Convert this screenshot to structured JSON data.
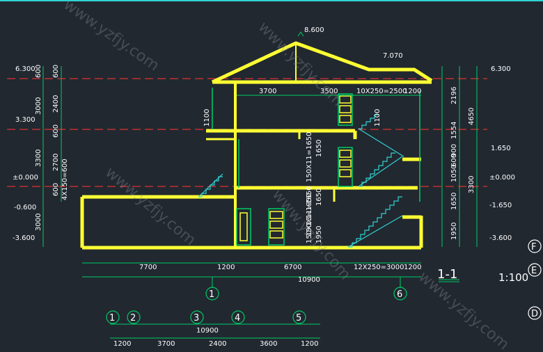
{
  "drawing": {
    "title": "1-1",
    "scale": "1:100",
    "ridge_elevation": "8.600",
    "eave_elevation": "7.070"
  },
  "elevations_left": [
    "6.300",
    "3.300",
    "±0.000",
    "-0.600",
    "-3.600"
  ],
  "elevations_right": [
    "6.300",
    "1.650",
    "±0.000",
    "-1.650",
    "-3.600"
  ],
  "dims_left_outer": [
    "600",
    "3000",
    "3300",
    "3000"
  ],
  "dims_left_inner": [
    "600",
    "2400",
    "600",
    "2700",
    "600",
    "4X150=600"
  ],
  "dims_right_inner": [
    "2196",
    "1554",
    "900",
    "1050",
    "600",
    "1650",
    "1950"
  ],
  "dims_right_outer": [
    "4650",
    "3300"
  ],
  "dims_upper": [
    "3700",
    "3500",
    "10X250=2500",
    "1200"
  ],
  "dims_middle_vertical": [
    "1100",
    "1100",
    "150X11=1650",
    "1650",
    "150X11=1650",
    "1650",
    "150X13=1950",
    "1950"
  ],
  "dims_bottom_row": [
    "7700",
    "1200",
    "6700",
    "12X250=3000",
    "1200"
  ],
  "dims_bottom_total": "10900",
  "axis_labels_section": [
    "1",
    "6"
  ],
  "axis_labels_right": [
    "F",
    "E",
    "D"
  ],
  "plan_axis_labels": [
    "1",
    "2",
    "3",
    "4",
    "5"
  ],
  "plan_total": "10900",
  "plan_dims": [
    "1200",
    "3700",
    "2400",
    "3600",
    "1200"
  ],
  "watermark": "www.yzfjy.com"
}
